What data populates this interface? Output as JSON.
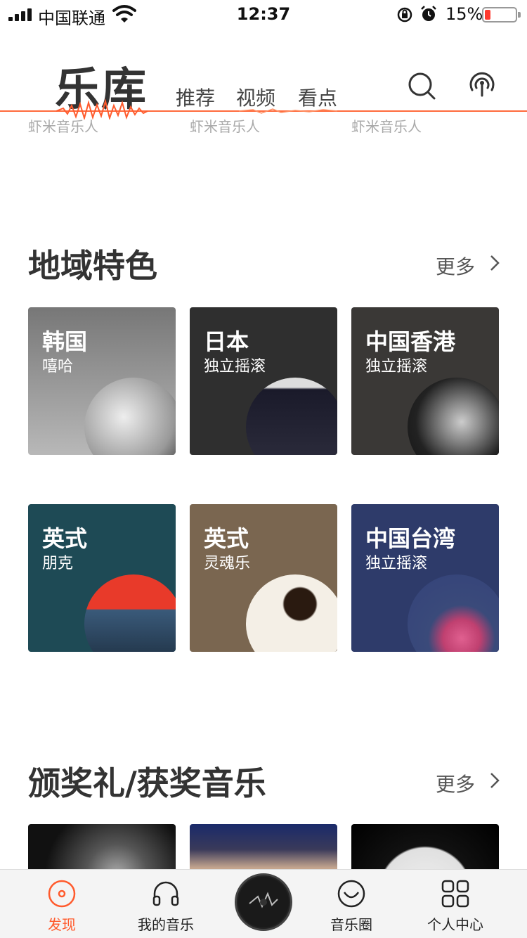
{
  "status_bar": {
    "carrier": "中国联通",
    "time": "12:37",
    "battery_percent": "15%"
  },
  "header": {
    "title": "乐库",
    "tabs": [
      "推荐",
      "视频",
      "看点"
    ],
    "captions": [
      "虾米音乐人",
      "虾米音乐人",
      "虾米音乐人"
    ]
  },
  "regional": {
    "title": "地域特色",
    "more": "更多",
    "cards": [
      {
        "title": "韩国",
        "subtitle": "嘻哈",
        "color": "#8a8a8a"
      },
      {
        "title": "日本",
        "subtitle": "独立摇滚",
        "color": "#2f2f2f"
      },
      {
        "title": "中国香港",
        "subtitle": "独立摇滚",
        "color": "#3a3836"
      },
      {
        "title": "英式",
        "subtitle": "朋克",
        "color": "#1e4a55"
      },
      {
        "title": "英式",
        "subtitle": "灵魂乐",
        "color": "#7a6650"
      },
      {
        "title": "中国台湾",
        "subtitle": "独立摇滚",
        "color": "#2e3b6a"
      }
    ]
  },
  "awards": {
    "title": "颁奖礼/获奖音乐",
    "more": "更多"
  },
  "tabbar": {
    "items": [
      "发现",
      "我的音乐",
      "音乐圈",
      "个人中心"
    ],
    "accent": "#ff5a2c"
  }
}
